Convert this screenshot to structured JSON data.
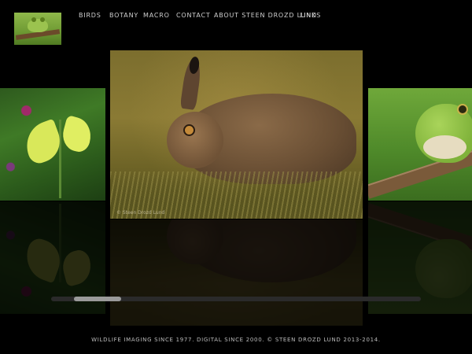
{
  "nav": {
    "items": [
      "BIRDS",
      "BOTANY",
      "MACRO",
      "CONTACT",
      "ABOUT STEEN DROZD LUND",
      "LINKS"
    ]
  },
  "gallery": {
    "center_watermark": "© Steen Drozd Lund",
    "scroll_fraction": 0.07
  },
  "footer": {
    "text": "WILDLIFE IMAGING SINCE 1977. DIGITAL SINCE 2000. © STEEN DROZD LUND 2013-2014."
  },
  "icons": [
    "frog-logo-icon"
  ]
}
